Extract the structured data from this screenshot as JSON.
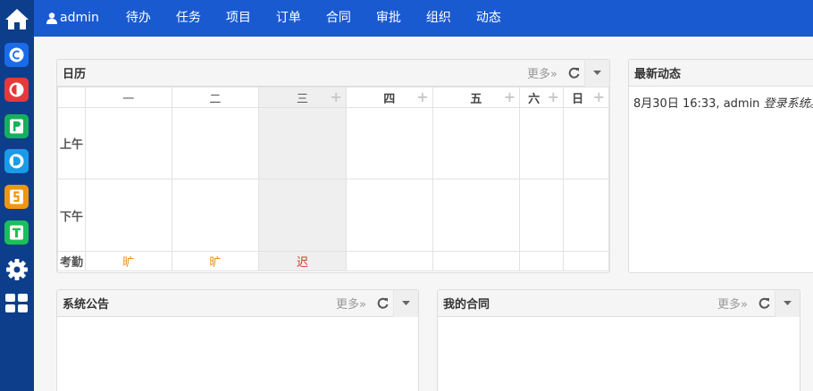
{
  "nav": {
    "user": "admin",
    "items": [
      "待办",
      "任务",
      "项目",
      "订单",
      "合同",
      "审批",
      "组织",
      "动态"
    ]
  },
  "apps": [
    {
      "letter": "C",
      "color": "#1a6be8"
    },
    {
      "letter": "O",
      "color": "#e83838"
    },
    {
      "letter": "P",
      "color": "#17b05a"
    },
    {
      "letter": "D",
      "color": "#1a9be8"
    },
    {
      "letter": "S",
      "color": "#f0960e"
    },
    {
      "letter": "T",
      "color": "#1cbf55"
    }
  ],
  "calendar": {
    "title": "日历",
    "more": "更多»",
    "days": [
      "一",
      "二",
      "三",
      "四",
      "五",
      "六",
      "日"
    ],
    "rows": {
      "morning": "上午",
      "afternoon": "下午",
      "attendance": "考勤"
    },
    "attendance": [
      "旷",
      "旷",
      "迟",
      "",
      "",
      "",
      ""
    ]
  },
  "feed": {
    "title": "最新动态",
    "entry": {
      "time": "8月30日 16:33,",
      "user": "admin",
      "action": "登录系统",
      "end": "。"
    }
  },
  "notice": {
    "title": "系统公告",
    "more": "更多»"
  },
  "contracts": {
    "title": "我的合同",
    "more": "更多»"
  },
  "colors": {
    "nav_bg": "#1a5ad1",
    "sidebar_bg": "#0d3e8c",
    "absent": "#e8901a",
    "late": "#d23b2b"
  }
}
